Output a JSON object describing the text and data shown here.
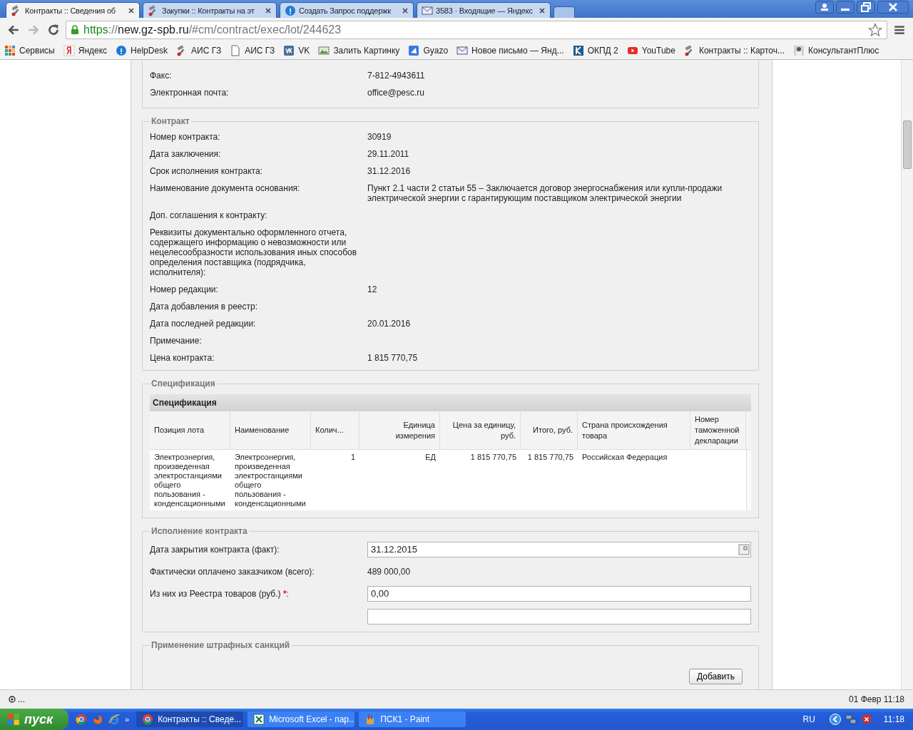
{
  "browser": {
    "tabs": [
      {
        "title": "Контракты :: Сведения об",
        "kind": "hammer",
        "selected": true
      },
      {
        "title": "Закупки :: Контракты на эт",
        "kind": "hammer",
        "selected": false
      },
      {
        "title": "Создать Запрос поддержк",
        "kind": "help",
        "selected": false
      },
      {
        "title": "3583 · Входящие — Яндекс",
        "kind": "mail",
        "selected": false
      }
    ],
    "url": {
      "scheme": "https",
      "separator": "://",
      "host": "new.gz-spb.ru",
      "path": "/#cm/contract/exec/lot/244623"
    },
    "bookmarks": [
      {
        "label": "Сервисы",
        "kind": "grid"
      },
      {
        "label": "Яндекс",
        "kind": "yandex"
      },
      {
        "label": "HelpDesk",
        "kind": "help"
      },
      {
        "label": "АИС ГЗ",
        "kind": "hammer"
      },
      {
        "label": "АИС ГЗ",
        "kind": "doc"
      },
      {
        "label": "VK",
        "kind": "vk"
      },
      {
        "label": "Залить Картинку",
        "kind": "image"
      },
      {
        "label": "Gyazo",
        "kind": "gyazo"
      },
      {
        "label": "Новое письмо — Янд...",
        "kind": "mail"
      },
      {
        "label": "ОКПД 2",
        "kind": "k"
      },
      {
        "label": "YouTube",
        "kind": "youtube"
      },
      {
        "label": "Контракты :: Карточ...",
        "kind": "hammer"
      },
      {
        "label": "КонсультантПлюс",
        "kind": "person"
      }
    ]
  },
  "contact_section": {
    "rows": [
      {
        "label": "Факс:",
        "value": "7-812-4943611"
      },
      {
        "label": "Электронная почта:",
        "value": "office@pesc.ru"
      }
    ]
  },
  "contract_section": {
    "legend": "Контракт",
    "rows": [
      {
        "label": "Номер контракта:",
        "value": "30919"
      },
      {
        "label": "Дата заключения:",
        "value": "29.11.2011"
      },
      {
        "label": "Срок исполнения контракта:",
        "value": "31.12.2016"
      },
      {
        "label": "Наименование документа основания:",
        "value": "Пункт 2.1 части 2 статьи 55 – Заключается договор энергоснабжения или купли-продажи электрической энергии с гарантирующим поставщиком электрической энергии"
      },
      {
        "label": "Доп. соглашения к контракту:"
      },
      {
        "label": "Реквизиты документально оформленного отчета, содержащего информацию о невозможности или нецелесообразности использования иных способов определения поставщика (подрядчика, исполнителя):"
      },
      {
        "label": "Номер редакции:",
        "value": "12"
      },
      {
        "label": "Дата добавления в реестр:"
      },
      {
        "label": "Дата последней редакции:",
        "value": "20.01.2016"
      },
      {
        "label": "Примечание:"
      },
      {
        "label": "Цена контракта:",
        "value": "1 815 770,75"
      }
    ]
  },
  "spec_section": {
    "legend": "Спецификация",
    "table_title": "Спецификация",
    "columns": [
      "Позиция лота",
      "Наименование",
      "Колич...",
      "Единица измерения",
      "Цена за единицу, руб.",
      "Итого, руб.",
      "Страна происхождения товара",
      "Номер таможенной декларации"
    ],
    "rows": [
      [
        "Электроэнергия, произведенная электростанциями общего пользования - конденсационными",
        "Электроэнергия, произведенная электростанциями общего пользования - конденсационными",
        "1",
        "ЕД",
        "1 815 770,75",
        "1 815 770,75",
        "Российская Федерация",
        null
      ]
    ]
  },
  "execution_section": {
    "legend": "Исполнение контракта",
    "rows": [
      {
        "kind": "date",
        "label": "Дата закрытия контракта (факт):",
        "value": "31.12.2015"
      },
      {
        "kind": "text",
        "label": "Фактически оплачено заказчиком (всего):",
        "value": "489 000,00"
      },
      {
        "kind": "input",
        "label": "Из них из Реестра товаров (руб.) ",
        "required_mark": "*",
        "label_end": ":",
        "value": "0,00"
      },
      {
        "kind": "input"
      }
    ]
  },
  "penalties_section": {
    "legend": "Применение штрафных санкций",
    "button": "Добавить"
  },
  "status_bar": {
    "left": "...",
    "right": "01 Февр 11:18"
  },
  "taskbar": {
    "start": "пуск",
    "more": "»",
    "tasks": [
      {
        "title": "Контракты :: Сведе...",
        "kind": "chrome",
        "selected": true
      },
      {
        "title": "Microsoft Excel - пар...",
        "kind": "excel",
        "selected": false
      },
      {
        "title": "ПСК1 - Paint",
        "kind": "paint",
        "selected": false
      }
    ],
    "language": "RU",
    "clock": "11:18"
  }
}
